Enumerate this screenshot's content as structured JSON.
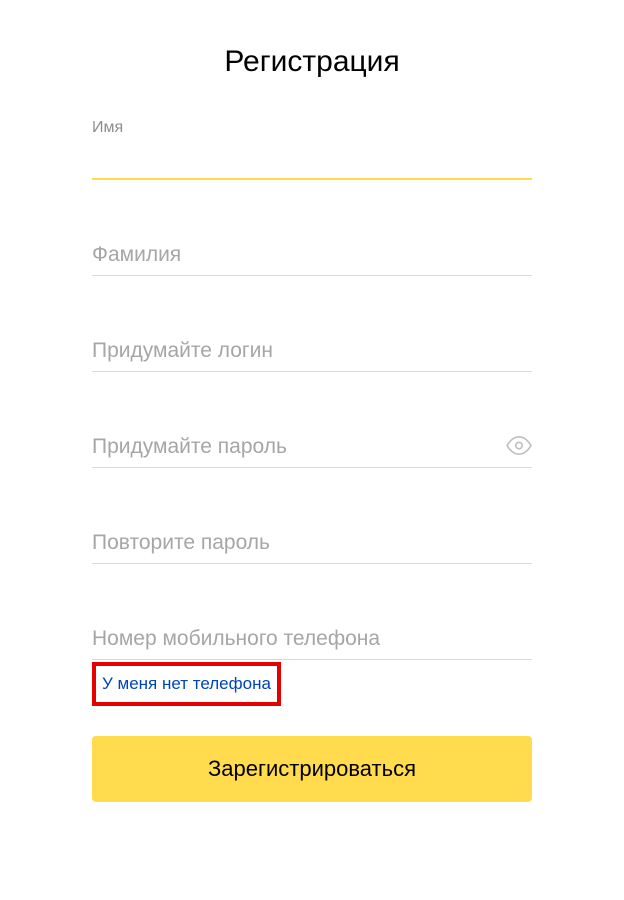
{
  "title": "Регистрация",
  "fields": {
    "firstname": {
      "label": "Имя",
      "value": ""
    },
    "lastname": {
      "placeholder": "Фамилия"
    },
    "login": {
      "placeholder": "Придумайте логин"
    },
    "password": {
      "placeholder": "Придумайте пароль"
    },
    "password_confirm": {
      "placeholder": "Повторите пароль"
    },
    "phone": {
      "placeholder": "Номер мобильного телефона"
    }
  },
  "no_phone_link": "У меня нет телефона",
  "submit_label": "Зарегистрироваться"
}
